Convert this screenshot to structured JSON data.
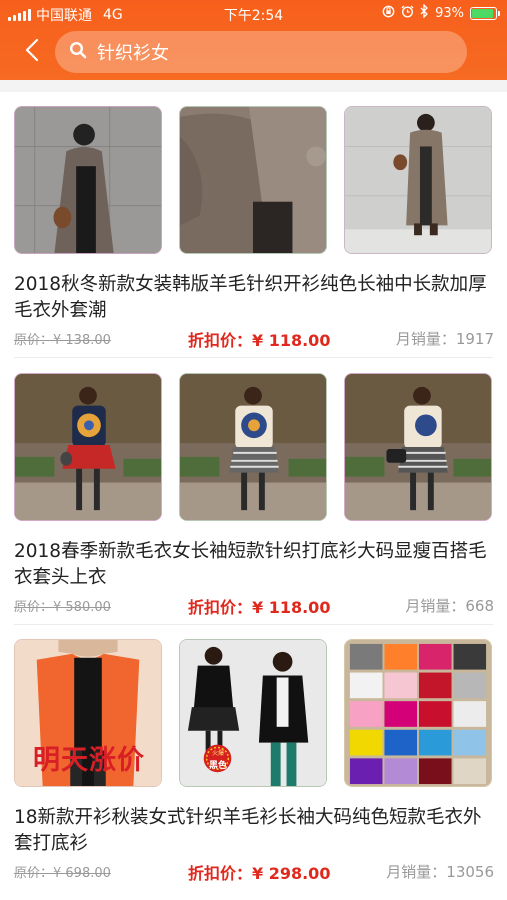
{
  "status_bar": {
    "carrier": "中国联通",
    "network": "4G",
    "time": "下午2:54",
    "battery_pct": "93%",
    "battery_level": 0.93
  },
  "search": {
    "query": "针织衫女",
    "back_icon": "chevron-left-icon",
    "search_icon": "magnifier-icon"
  },
  "colors": {
    "header": "#f7601c",
    "discount_price": "#e0281d",
    "muted": "#999999"
  },
  "products": [
    {
      "title": "2018秋冬新款女装韩版羊毛针织开衫纯色长袖中长款加厚毛衣外套潮",
      "original_price": "原价：¥ 138.00",
      "discount_price": "折扣价：¥ 118.00",
      "monthly_sales": "月销量：1917"
    },
    {
      "title": "2018春季新款毛衣女长袖短款针织打底衫大码显瘦百搭毛衣套头上衣",
      "original_price": "原价：¥ 580.00",
      "discount_price": "折扣价：¥ 118.00",
      "monthly_sales": "月销量：668"
    },
    {
      "title": "18新款开衫秋装女式针织羊毛衫长袖大码纯色短款毛衣外套打底衫",
      "original_price": "原价：¥ 698.00",
      "discount_price": "折扣价：¥ 298.00",
      "monthly_sales": "月销量：13056",
      "image_caption": "明天涨价",
      "badge_text": "黑色",
      "badge_top": "火爆"
    }
  ]
}
